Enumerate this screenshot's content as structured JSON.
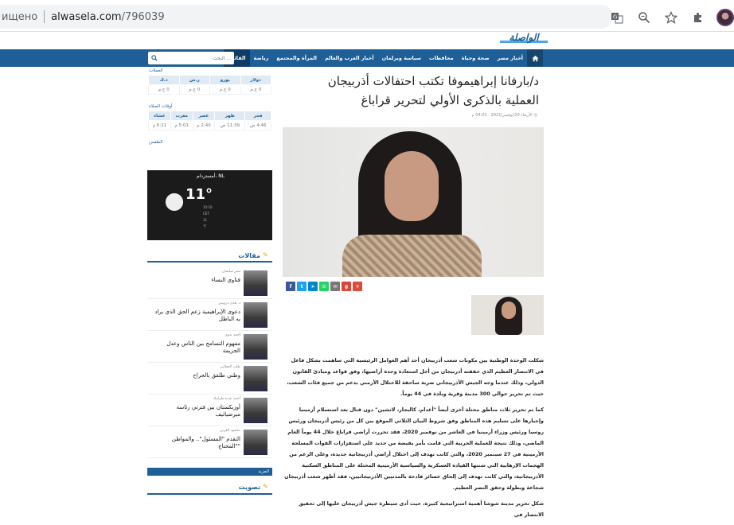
{
  "browser": {
    "url_prefix": "ищено",
    "url_host": "alwasela.com",
    "url_path": "/796039",
    "icons": [
      "translate-icon",
      "zoom-icon",
      "bookmark-star-icon",
      "extensions-icon",
      "profile-avatar"
    ]
  },
  "site": {
    "logo": "الواصلة",
    "nav": [
      "أخبار مصر",
      "صحة وحياة",
      "محافظات",
      "سياسة وبرلمان",
      "أخبار العرب والعالم",
      "المرأة والمجتمع",
      "رياضة",
      "القائمة"
    ],
    "search_placeholder": "البحث ..."
  },
  "sidebar": {
    "currency_title": "العملات",
    "currency_headers": [
      "دولار",
      "يورو",
      "ر.س",
      "د.ك"
    ],
    "currency_values": [
      "0 ج.م",
      "0 ج.م",
      "0 ج.م",
      "0 ج.م"
    ],
    "prayer_title": "أوقات الصلاة",
    "prayer_headers": [
      "فجر",
      "ظهر",
      "عصر",
      "مغرب",
      "عشاء"
    ],
    "prayer_values": [
      "4:46 ص",
      "11:39 ص",
      "2:40 م",
      "5:01 م",
      "6:21 م"
    ],
    "weather_title": "الطقس",
    "weather_city": "أمستردام، NL",
    "weather_temp": "11°",
    "weather_details": [
      "10:10",
      "CET",
      "11",
      "°F"
    ],
    "articles_title": "مقالات",
    "articles": [
      {
        "author": "منير سليمان",
        "title": "فتاوي النساء"
      },
      {
        "author": "د. هدى درويش",
        "title": "دعوى الإبراهيمية زعم الحق الذي يراد به الباطل"
      },
      {
        "author": "أحمد بدوي",
        "title": "مفهوم التسامح بين الناس وعدل الجريمة"
      },
      {
        "author": "طلب العطابي",
        "title": "وطني طلقق بالجراح"
      },
      {
        "author": "أحمد عبده طرابيك",
        "title": "أوزبكستان بين فترتي رئاسة ميرضيائيف"
      },
      {
        "author": "محمود العربي",
        "title": "التقدم \"المسئول\".. والمواطن \"المحتاج\""
      }
    ],
    "more_label": "المزيد",
    "vote_label": "تصويت"
  },
  "article": {
    "title": "د/بارفانا إبراهيموفا تكتب احتفالات أذربيجان العملية بالذكرى الأولي لتحرير قراباغ",
    "meta": "الأربعاء 10/نوفمبر/2021 - 04:01 م",
    "share_colors": [
      "#3b5998",
      "#1da1f2",
      "#0088cc",
      "#25d366",
      "#777777",
      "#db4437",
      "#dd4b39"
    ],
    "paragraphs": [
      "شكلت الوحدة الوطنية بين مكونات شعب أذربيجان أحد أهم العوامل الرئيسية التي ساهمت بشكل فاعل في الانتصار العظيم الذي حققته أذربيجان من أجل استعادة وحدة أراضيها، وفق قواعد ومبادئ القانون الدولي، وذلك عندما وجه الجيش الأذربيجاني ضربة ساحقة للاحتلال الأرمني بدعم من جميع فئات الشعب، حيث تم تحرير حوالي 300 مدينة وقرية وبلدة في 44 يوماً.",
      "كما تم تحرير ثلاث مناطق محتلة أخرى أيضاً \"أغدام، كالبجار، لاتشين\" دون قتال بعد استسلام أرمينيا وإجبارها على تسليم هذه المناطق وفق شروط البيان الثلاثي الموقع بين كل من رئيس أذربيجان ورئيس روسيا ورئيس وزراء أرمينيا في العاشر من نوفمبر 2020، فقد تحررت أراضي قراباغ خلال 44 يوماً العام الماضي، وذلك نتيجة للعملية الحربية التي قامت بأمر بقيضة من حديد على استفزازات القوات المسلحة الأرمينية في 27 سبتمبر 2020، والتي كانت تهدف إلى احتلال أراضي أذربيجانية جديدة، وعلى الرغم من الهجمات الإرهابية التي شنتها القيادة العسكرية والسياسية الأرمينية المحتلة على المناطق السكنية الأذربيجانية، والتي كانت تهدف إلى إلحاق خسائر فادحة بالمدنيين الأذربيجانيين، فقد أظهر شعب أذربيجان شجاعة وبطولة وحقق النصر العظيم.",
      "شكل تحرير مدينة شوشا أهمية استراتيجية كبيرة، حيث أدى سيطرة جيش أذربيجان عليها إلى تحقيق الانتصار في"
    ]
  }
}
